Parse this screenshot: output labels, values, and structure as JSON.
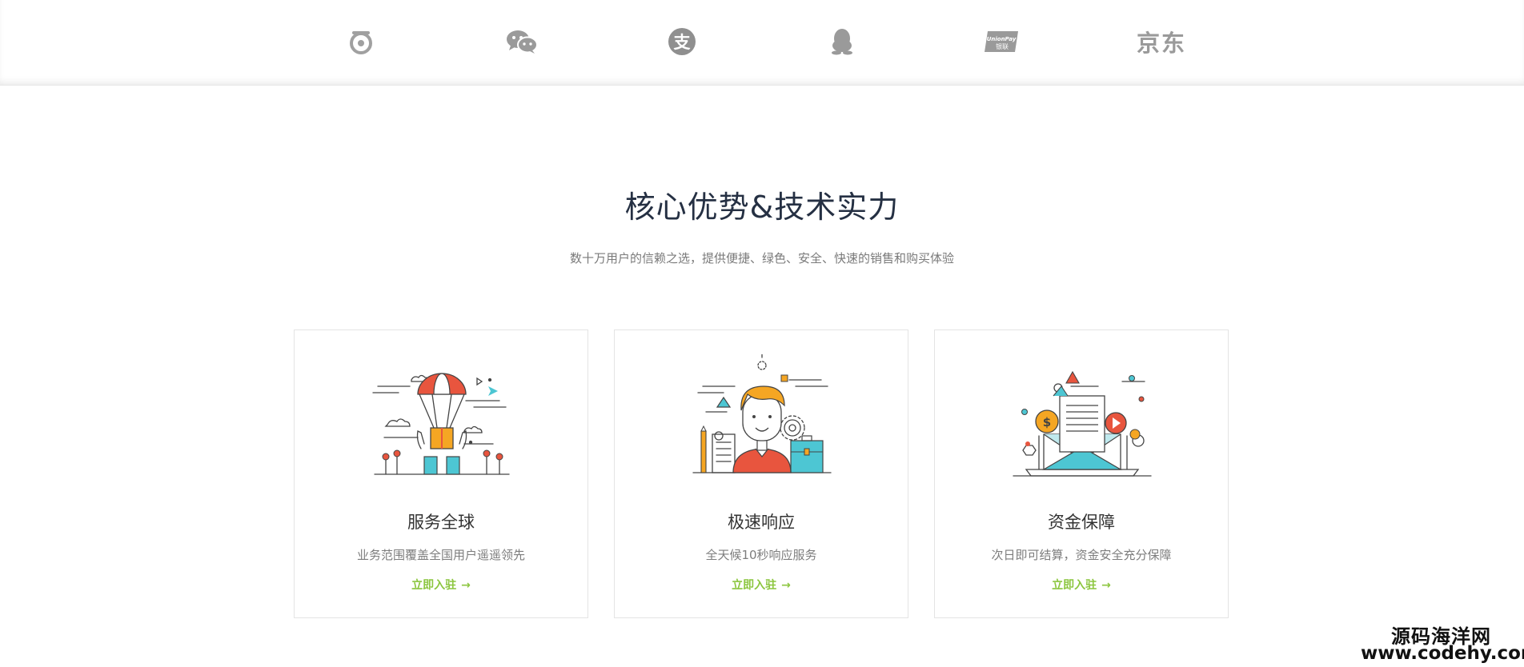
{
  "payment_logos": [
    {
      "name": "tenpay-icon"
    },
    {
      "name": "wechat-icon"
    },
    {
      "name": "alipay-icon",
      "glyph": "支"
    },
    {
      "name": "qq-icon"
    },
    {
      "name": "unionpay-icon",
      "text": "UnionPay",
      "subtext": "银联"
    },
    {
      "name": "jd-logo",
      "text": "京东"
    }
  ],
  "section": {
    "title": "核心优势&技术实力",
    "subtitle": "数十万用户的信赖之选，提供便捷、绿色、安全、快速的销售和购买体验"
  },
  "cards": [
    {
      "title": "服务全球",
      "desc": "业务范围覆盖全国用户遥遥领先",
      "link": "立即入驻",
      "arrow": "→"
    },
    {
      "title": "极速响应",
      "desc": "全天候10秒响应服务",
      "link": "立即入驻",
      "arrow": "→"
    },
    {
      "title": "资金保障",
      "desc": "次日即可结算，资金安全充分保障",
      "link": "立即入驻",
      "arrow": "→"
    }
  ],
  "colors": {
    "accent_green": "#8cc63f",
    "title_dark": "#253043",
    "logo_gray": "#9a9a9a",
    "illus_orange": "#f5a623",
    "illus_red": "#e8553e",
    "illus_teal": "#4dc6d3"
  },
  "watermark": {
    "line1": "源码海洋网",
    "line2": "www.codehy.com"
  }
}
